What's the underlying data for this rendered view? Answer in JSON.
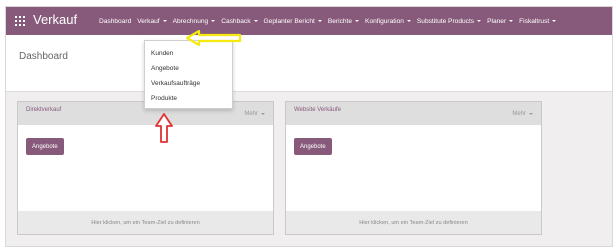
{
  "app": {
    "title": "Verkauf"
  },
  "navbar": {
    "items": [
      {
        "label": "Dashboard",
        "caret": false
      },
      {
        "label": "Verkauf",
        "caret": true
      },
      {
        "label": "Abrechnung",
        "caret": true
      },
      {
        "label": "Cashback",
        "caret": true
      },
      {
        "label": "Geplanter Bericht",
        "caret": true
      },
      {
        "label": "Berichte",
        "caret": true
      },
      {
        "label": "Konfiguration",
        "caret": true
      },
      {
        "label": "Substitute Products",
        "caret": true
      },
      {
        "label": "Planer",
        "caret": true
      },
      {
        "label": "Fiskaltrust",
        "caret": true
      }
    ]
  },
  "page": {
    "title": "Dashboard"
  },
  "dropdown": {
    "items": [
      "Kunden",
      "Angebote",
      "Verkaufsaufträge",
      "Produkte"
    ]
  },
  "cards": [
    {
      "title": "Direktverkauf",
      "more_label": "Mehr",
      "button_label": "Angebote",
      "footer": "Hier klicken, um ein Team-Ziel zu definieren"
    },
    {
      "title": "Website Verkäufe",
      "more_label": "Mehr",
      "button_label": "Angebote",
      "footer": "Hier klicken, um ein Team-Ziel zu definieren"
    }
  ],
  "colors": {
    "brand": "#875a7b",
    "annotation_yellow": "#f5e90f",
    "annotation_red": "#e03131"
  },
  "icons": {
    "apps": "apps-grid-icon",
    "caret": "caret-down-icon"
  }
}
